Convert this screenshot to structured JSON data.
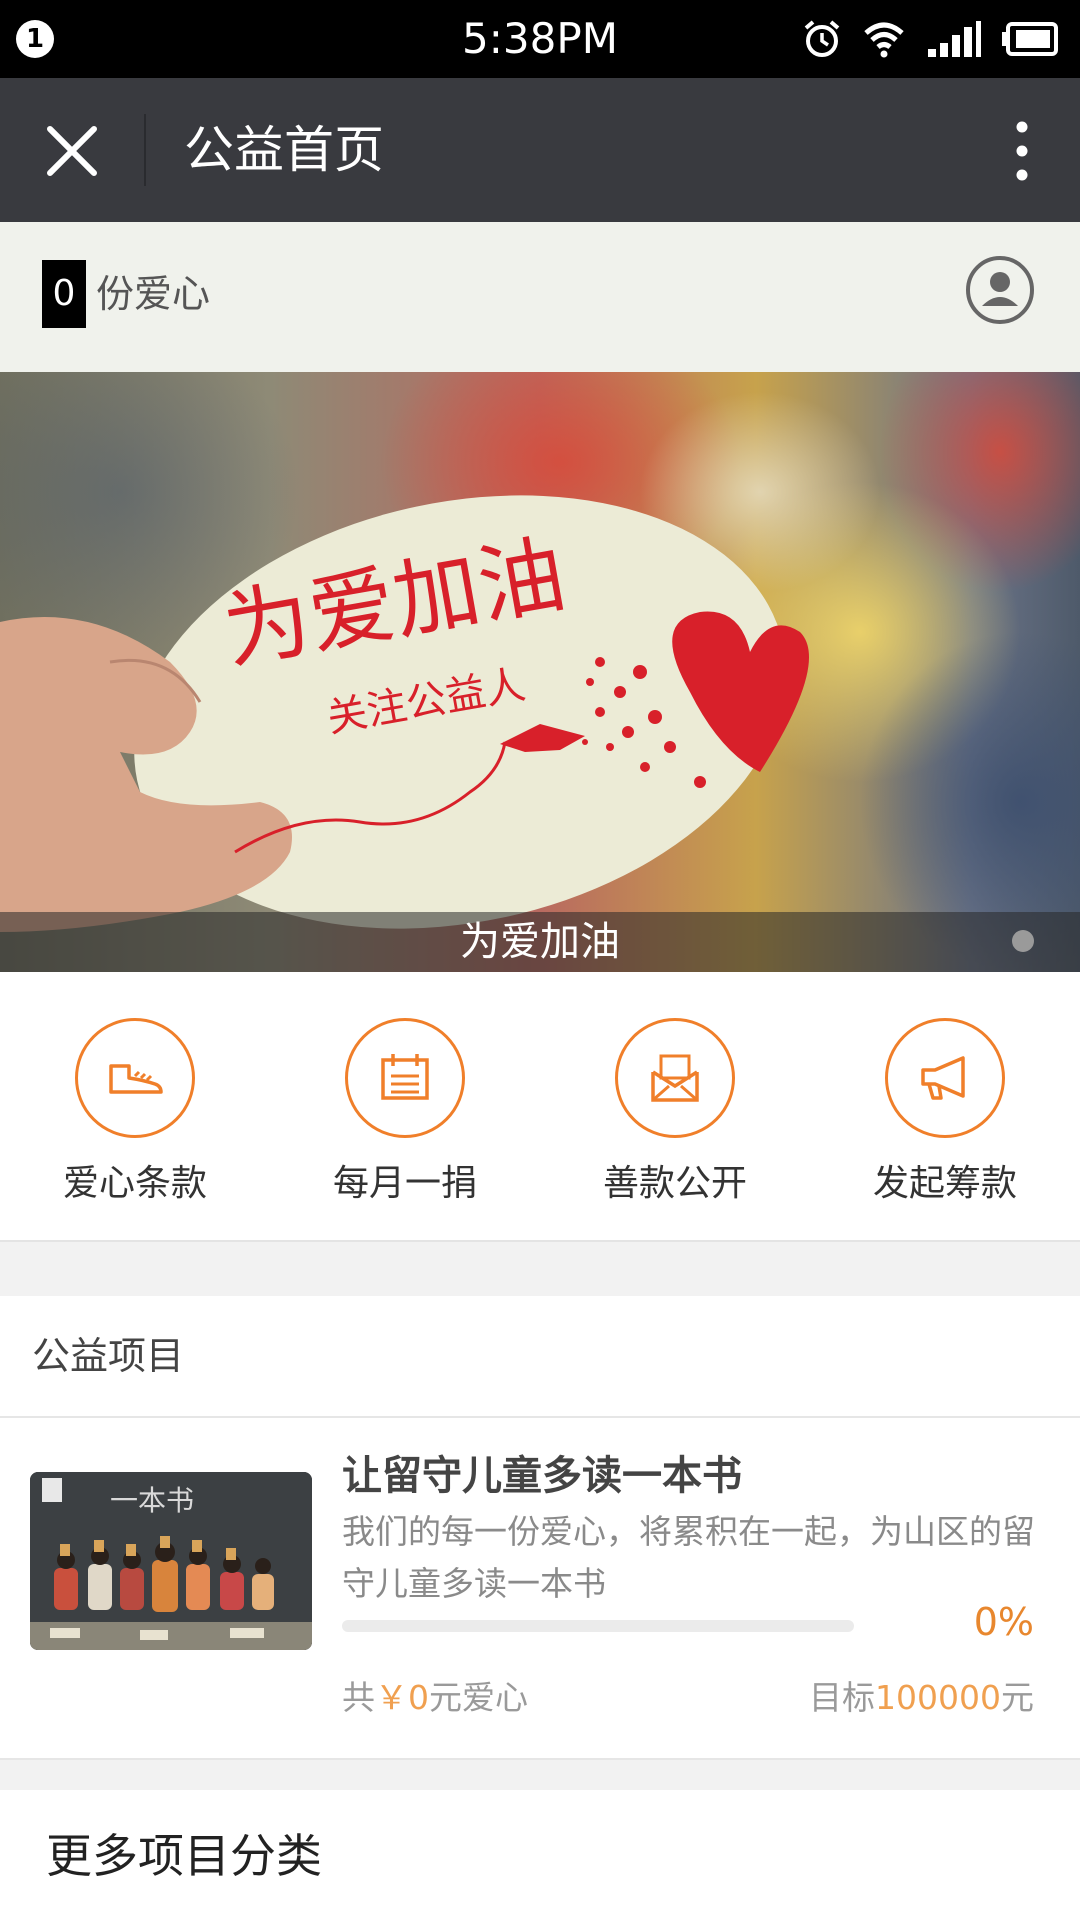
{
  "status_bar": {
    "notification_count": "1",
    "time": "5:38PM",
    "icons": [
      "alarm-icon",
      "wifi-icon",
      "signal-icon",
      "battery-icon"
    ]
  },
  "nav": {
    "title": "公益首页",
    "close_icon": "close-icon",
    "more_icon": "more-vertical-icon"
  },
  "love_bar": {
    "count": "0",
    "label": "份爱心",
    "user_icon": "user-icon"
  },
  "banner": {
    "headline": "为爱加油",
    "subline": "关注公益人",
    "caption": "为爱加油",
    "active_slide": 1,
    "slide_count": 1
  },
  "actions": [
    {
      "label": "爱心条款",
      "icon": "shoe-icon"
    },
    {
      "label": "每月一捐",
      "icon": "calendar-icon"
    },
    {
      "label": "善款公开",
      "icon": "envelope-icon"
    },
    {
      "label": "发起筹款",
      "icon": "megaphone-icon"
    }
  ],
  "section": {
    "title": "公益项目"
  },
  "project": {
    "title": "让留守儿童多读一本书",
    "description": "我们的每一份爱心，将累积在一起，为山区的留守儿童多读一本书",
    "progress_percent": 0,
    "percent_label": "0%",
    "raised_prefix": "共",
    "raised_amount": "￥0",
    "raised_suffix": "元爱心",
    "goal_prefix": "目标",
    "goal_amount": "100000",
    "goal_suffix": "元",
    "chalkboard_text": "一本书"
  },
  "more": {
    "title": "更多项目分类"
  },
  "colors": {
    "accent": "#f07f2a",
    "navbar": "#393a3f",
    "love_bar": "#f0f2ec"
  }
}
